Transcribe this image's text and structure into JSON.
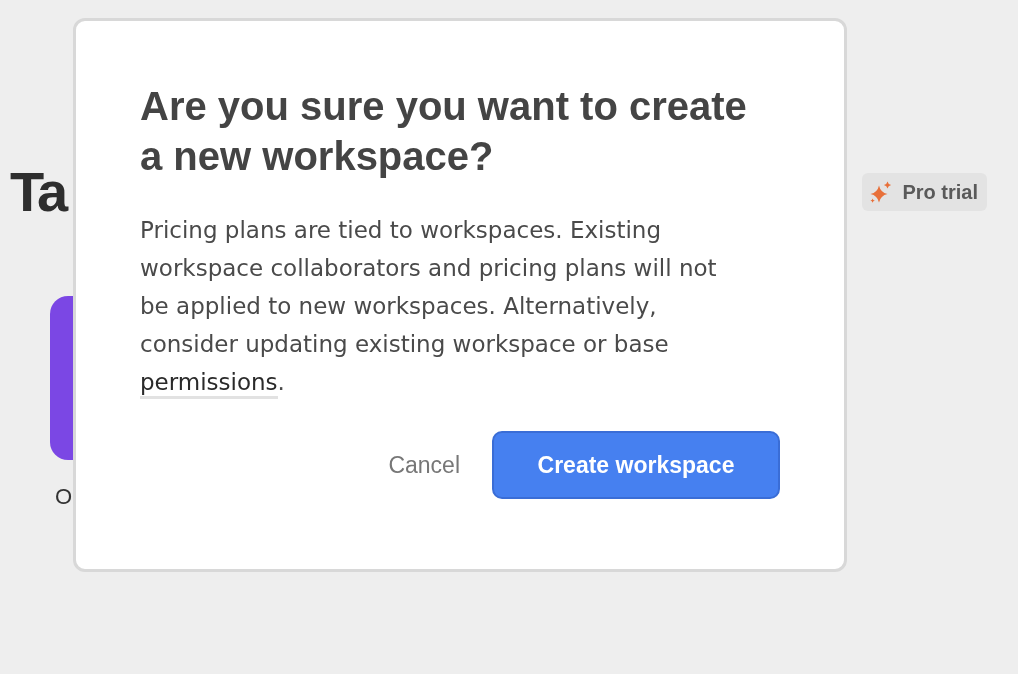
{
  "page": {
    "heading": "Ta",
    "badge": {
      "label": "Pro trial"
    },
    "tile_label": "O"
  },
  "dialog": {
    "title": "Are you sure you want to create a new workspace?",
    "body": {
      "text": "Pricing plans are tied to workspaces. Existing workspace collaborators and pricing plans will not be applied to new workspaces. Alternatively, consider updating existing workspace or base",
      "link": "permissions",
      "end": "."
    },
    "buttons": [
      {
        "label": "Cancel",
        "kind": "secondary"
      },
      {
        "label": "Create workspace",
        "kind": "primary"
      }
    ]
  }
}
